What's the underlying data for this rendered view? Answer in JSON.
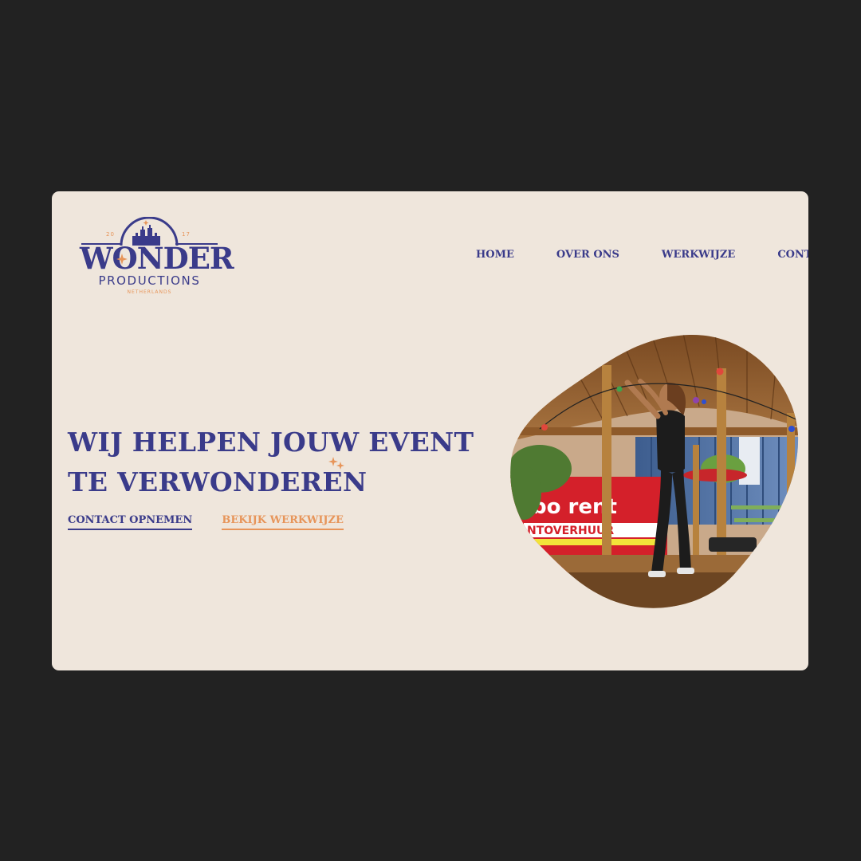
{
  "brand": {
    "name": "WONDER",
    "subtitle": "PRODUCTIONS",
    "country": "NETHERLANDS",
    "year_left": "20",
    "year_right": "17"
  },
  "nav": {
    "items": [
      {
        "label": "HOME"
      },
      {
        "label": "OVER ONS"
      },
      {
        "label": "WERKWIJZE"
      },
      {
        "label": "CONTACT"
      }
    ]
  },
  "hero": {
    "headline_line1": "WIJ HELPEN JOUW EVENT",
    "headline_line2": "TE VERWONDEREN",
    "cta_primary": "CONTACT OPNEMEN",
    "cta_secondary": "BEKIJK WERKWIJZE",
    "image_sign_text": "bo rent",
    "image_sign_sub": "NTOVERHUUR"
  },
  "colors": {
    "page_background": "#222222",
    "card_background": "#efe6dc",
    "primary": "#3a3b8a",
    "accent": "#e7955a"
  }
}
